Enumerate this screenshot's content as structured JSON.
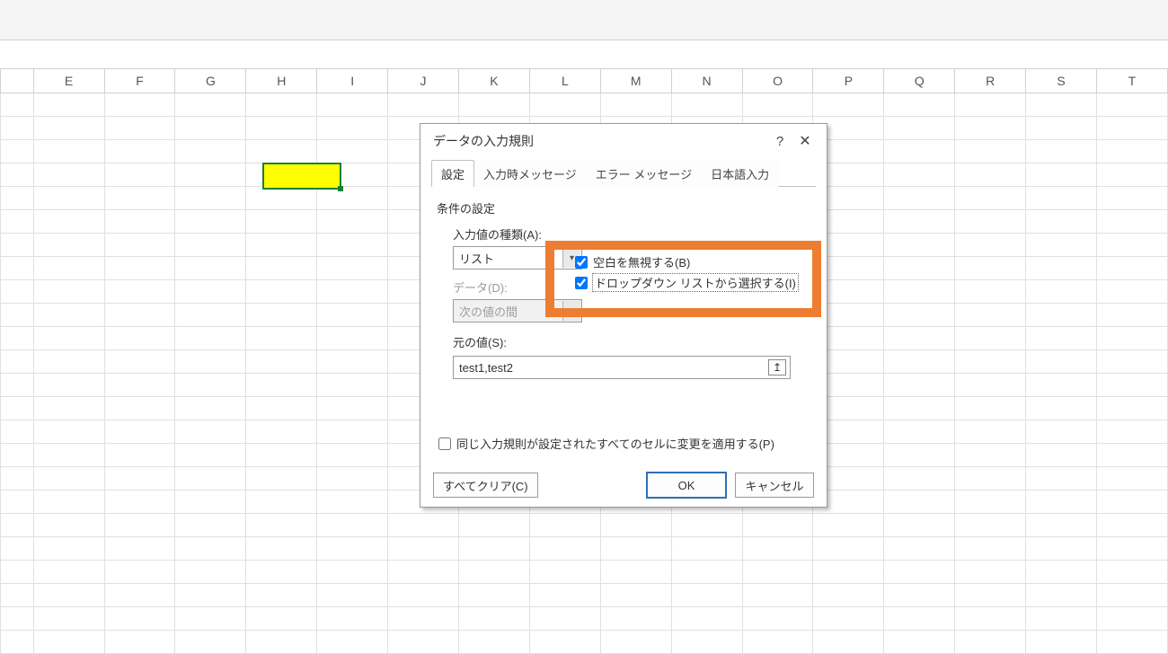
{
  "columns": [
    "E",
    "F",
    "G",
    "H",
    "I",
    "J",
    "K",
    "L",
    "M",
    "N",
    "O",
    "P",
    "Q",
    "R",
    "S",
    "T"
  ],
  "dialog": {
    "title": "データの入力規則",
    "tabs": [
      "設定",
      "入力時メッセージ",
      "エラー メッセージ",
      "日本語入力"
    ],
    "active_tab": 0,
    "group_label": "条件の設定",
    "allow_label": "入力値の種類(A):",
    "allow_value": "リスト",
    "data_label": "データ(D):",
    "data_value": "次の値の間",
    "ignore_blank_label": "空白を無視する(B)",
    "dropdown_label": "ドロップダウン リストから選択する(I)",
    "ignore_blank_checked": true,
    "dropdown_checked": true,
    "source_label": "元の値(S):",
    "source_value": "test1,test2",
    "apply_all_label": "同じ入力規則が設定されたすべてのセルに変更を適用する(P)",
    "apply_all_checked": false,
    "clear_btn": "すべてクリア(C)",
    "ok_btn": "OK",
    "cancel_btn": "キャンセル"
  }
}
